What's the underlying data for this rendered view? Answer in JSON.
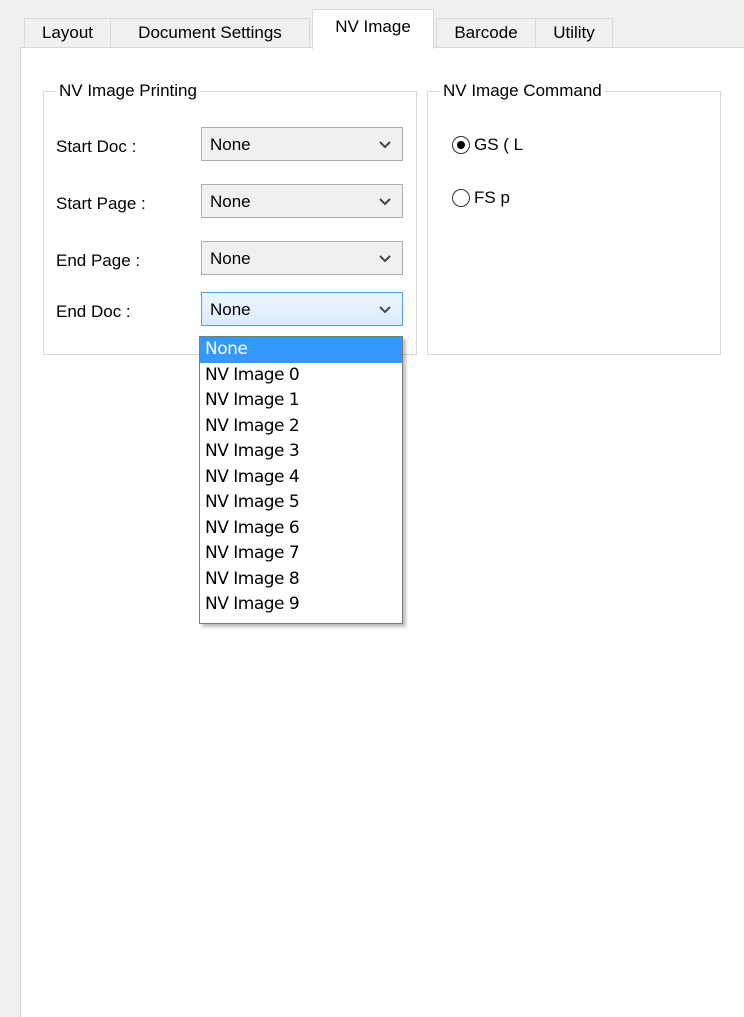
{
  "tabs": [
    {
      "label": "Layout"
    },
    {
      "label": "Document Settings"
    },
    {
      "label": "NV Image"
    },
    {
      "label": "Barcode"
    },
    {
      "label": "Utility"
    }
  ],
  "nv_printing": {
    "title": "NV Image Printing",
    "rows": [
      {
        "label": "Start Doc :",
        "value": "None"
      },
      {
        "label": "Start Page :",
        "value": "None"
      },
      {
        "label": "End Page :",
        "value": "None"
      },
      {
        "label": "End Doc :",
        "value": "None"
      }
    ]
  },
  "nv_command": {
    "title": "NV Image Command",
    "options": [
      {
        "label": "GS ( L",
        "checked": true
      },
      {
        "label": "FS p",
        "checked": false
      }
    ]
  },
  "dropdown": {
    "selected_index": 0,
    "options": [
      "None",
      "NV Image 0",
      "NV Image 1",
      "NV Image 2",
      "NV Image 3",
      "NV Image 4",
      "NV Image 5",
      "NV Image 6",
      "NV Image 7",
      "NV Image 8",
      "NV Image 9"
    ]
  },
  "colors": {
    "selection": "#3399ff",
    "focus_border": "#569de5"
  }
}
